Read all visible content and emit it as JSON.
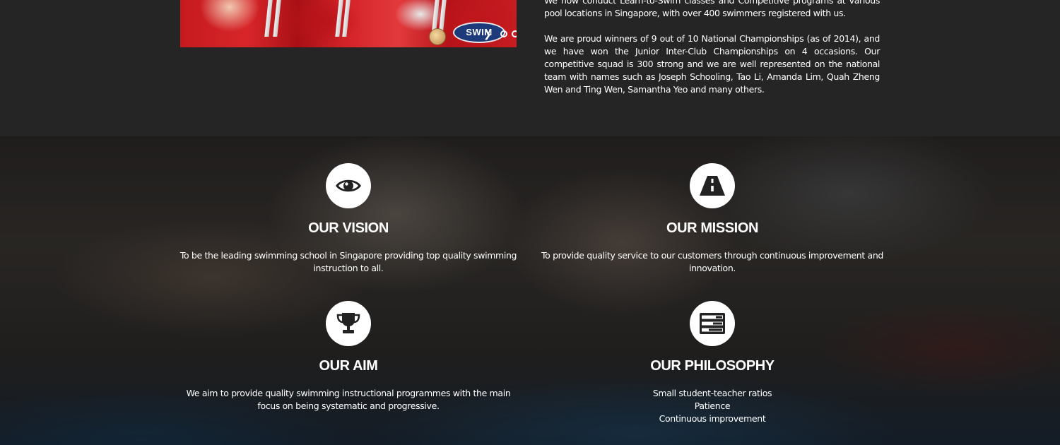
{
  "slider": {
    "sponsor_logo_text": "SWIM FAST",
    "next_icon": "chevron-right-icon",
    "pause_icon": "pause-icon",
    "dots_count": 5,
    "active_dot": 1
  },
  "about": {
    "paragraph_1": "We now conduct Learn-to-Swim classes and Competitive programs at various pool locations in Singapore, with over 400 swimmers registered with us.",
    "paragraph_2": "We are proud winners of 9 out of 10 National Championships (as of 2014), and we have won the Junior Inter-Club Championships on 4 occasions. Our competitive squad is 300 strong and we are well represented on the national team with names such as Joseph Schooling, Tao Li, Amanda Lim, Quah Zheng Wen and Ting Wen, Samantha Yeo and many others."
  },
  "values": {
    "vision": {
      "icon": "eye-icon",
      "title": "OUR VISION",
      "text": "To be the leading swimming school in Singapore providing top quality swimming instruction to all."
    },
    "mission": {
      "icon": "road-icon",
      "title": "OUR MISSION",
      "text": "To provide quality service to our customers through continuous improvement and innovation."
    },
    "aim": {
      "icon": "trophy-icon",
      "title": "OUR AIM",
      "text": "We aim to provide quality swimming instructional programmes with the main focus on being systematic and progressive."
    },
    "philosophy": {
      "icon": "tasks-icon",
      "title": "OUR PHILOSOPHY",
      "lines": [
        "Small student-teacher ratios",
        "Patience",
        "Continuous improvement"
      ]
    }
  },
  "colors": {
    "dark_background": "#252525",
    "icon_circle": "#ffffff",
    "text": "#ffffff",
    "photo_red": "#d52429"
  }
}
